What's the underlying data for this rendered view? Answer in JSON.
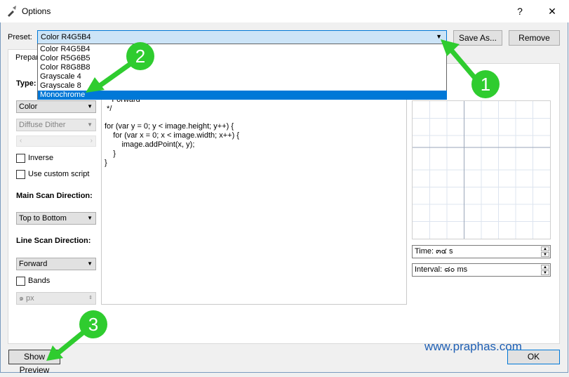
{
  "window": {
    "title": "Options",
    "help_label": "?",
    "close_label": "✕"
  },
  "preset": {
    "label": "Preset:",
    "selected": "Color R4G5B4",
    "save_as_label": "Save As...",
    "remove_label": "Remove",
    "options": [
      "Color R4G5B4",
      "Color R5G6B5",
      "Color R8G8B8",
      "Grayscale 4",
      "Grayscale 8",
      "Monochrome"
    ],
    "highlighted_option": "Monochrome"
  },
  "tabs": {
    "prepare_label": "Prepar"
  },
  "left_panel": {
    "type_label": "Type:",
    "type_value": "Color",
    "dither_value": "Diffuse Dither",
    "inverse_label": "Inverse",
    "custom_script_label": "Use custom script",
    "main_scan_label": "Main Scan Direction:",
    "main_scan_value": "Top to Bottom",
    "line_scan_label": "Line Scan Direction:",
    "line_scan_value": "Forward",
    "bands_label": "Bands",
    "bands_value": "๑ px"
  },
  "script": {
    "lines": [
      " * Forward",
      " */",
      "",
      "for (var y = 0; y < image.height; y++) {",
      "    for (var x = 0; x < image.width; x++) {",
      "        image.addPoint(x, y);",
      "    }",
      "}"
    ]
  },
  "right_panel": {
    "time_label": "Time: ๓๔ s",
    "interval_label": "Interval: ๘๐ ms"
  },
  "footer": {
    "show_preview_label": "Show Preview",
    "ok_label": "OK",
    "watermark": "www.praphas.com"
  },
  "markers": [
    "1",
    "2",
    "3"
  ],
  "colors": {
    "accent": "#0078d7",
    "marker": "#2fcc2f",
    "watermark": "#1e5fb4"
  }
}
